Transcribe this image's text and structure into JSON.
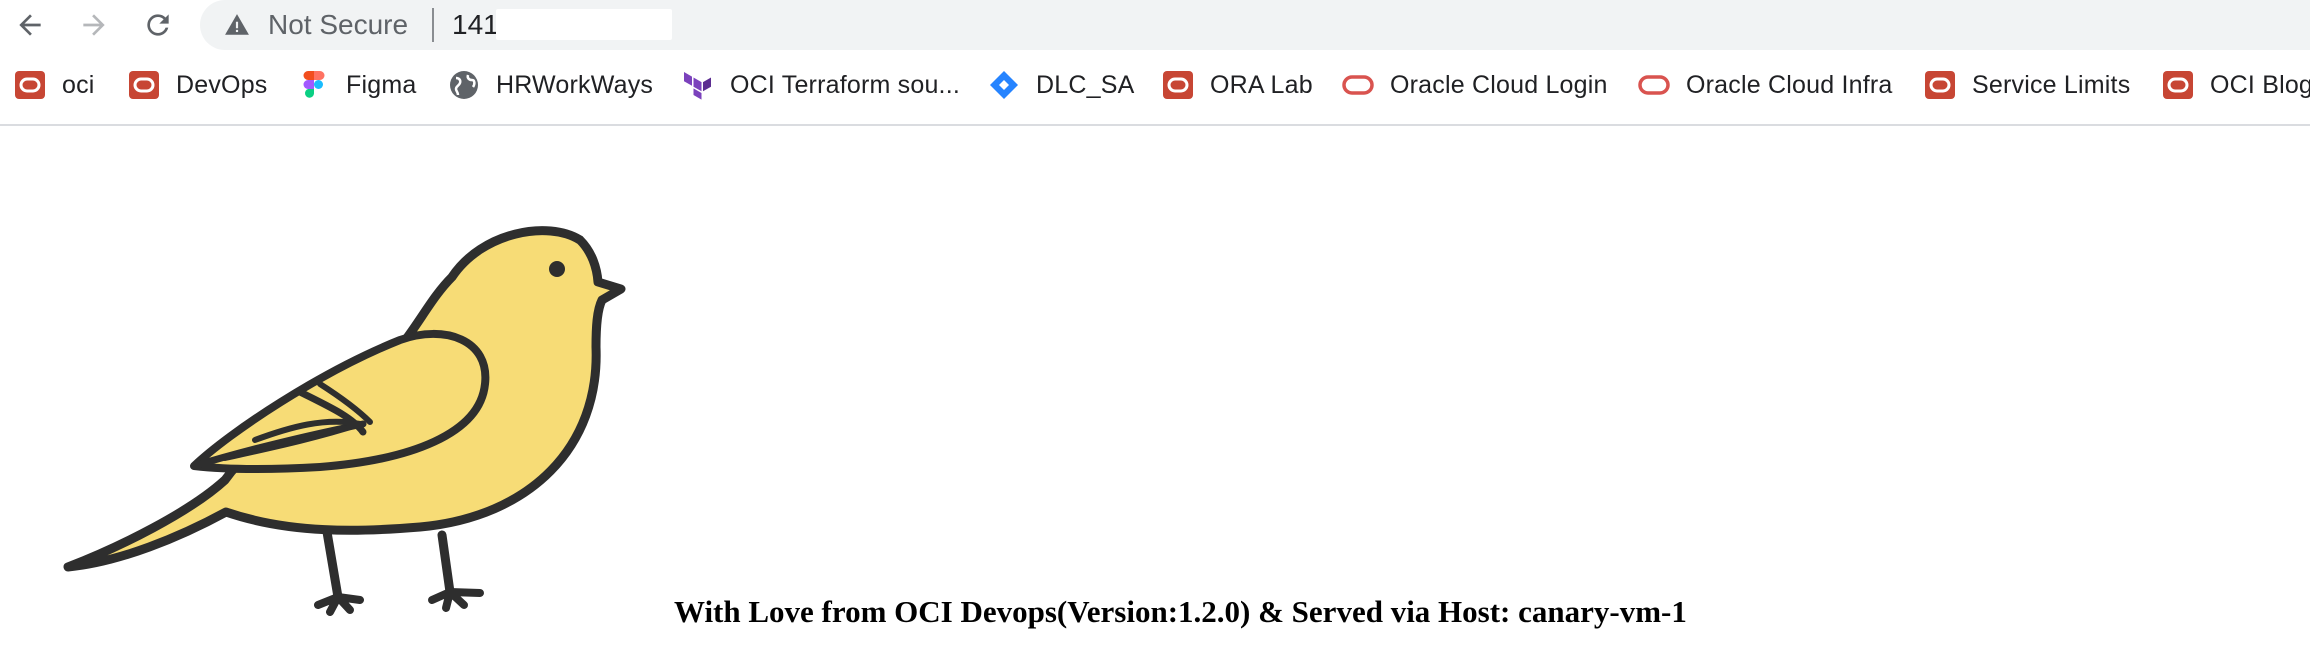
{
  "toolbar": {
    "back_icon": "arrow-left-icon",
    "forward_icon": "arrow-right-icon",
    "reload_icon": "reload-icon",
    "security_icon": "warning-triangle-icon",
    "security_label": "Not Secure",
    "url": "141"
  },
  "bookmarks": [
    {
      "label": "oci",
      "icon": "oracle-icon"
    },
    {
      "label": "DevOps",
      "icon": "oracle-icon"
    },
    {
      "label": "Figma",
      "icon": "figma-icon"
    },
    {
      "label": "HRWorkWays",
      "icon": "globe-icon"
    },
    {
      "label": "OCI Terraform sou...",
      "icon": "terraform-icon"
    },
    {
      "label": "DLC_SA",
      "icon": "jira-icon"
    },
    {
      "label": "ORA Lab",
      "icon": "oracle-icon"
    },
    {
      "label": "Oracle Cloud Login",
      "icon": "oracle-outline-icon"
    },
    {
      "label": "Oracle Cloud Infra",
      "icon": "oracle-outline-icon"
    },
    {
      "label": "Service Limits",
      "icon": "oracle-icon"
    },
    {
      "label": "OCI Blog",
      "icon": "oracle-icon"
    }
  ],
  "page": {
    "image": "canary-bird",
    "message": "With Love from OCI Devops(Version:1.2.0) & Served via Host: canary-vm-1"
  },
  "colors": {
    "oracle_red": "#c74634",
    "terraform_purple": "#7b42bc",
    "jira_blue": "#2684ff",
    "bird_yellow": "#f7dc76",
    "outline": "#2e2e2e"
  }
}
